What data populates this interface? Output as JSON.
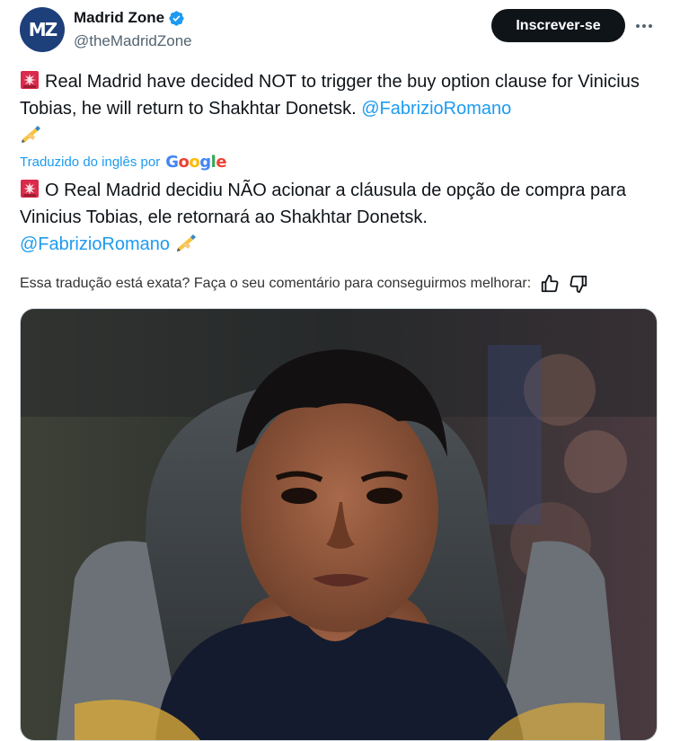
{
  "author": {
    "display_name": "Madrid Zone",
    "handle": "@theMadridZone",
    "avatar_text": "MZ",
    "verified_color": "#1d9bf0"
  },
  "actions": {
    "subscribe_label": "Inscrever-se",
    "more_icon": "more-horizontal-icon"
  },
  "tweet": {
    "original_text": "Real Madrid have decided NOT to trigger the buy option clause for Vinicius Tobias, he will return to Shakhtar Donetsk.",
    "original_mention": "@FabrizioRomano",
    "translation_label": "Traduzido do inglês por",
    "translation_brand": "Google",
    "translated_text": "O Real Madrid decidiu NÃO acionar a cláusula de opção de compra para Vinicius Tobias, ele retornará ao Shakhtar Donetsk.",
    "translated_mention": "@FabrizioRomano",
    "feedback_prompt": "Essa tradução está exata? Faça o seu comentário para conseguirmos melhorar:"
  },
  "colors": {
    "accent": "#1d9bf0",
    "text": "#0f1419",
    "muted": "#536471",
    "google_blue": "#4285f4",
    "google_red": "#ea4335",
    "google_yellow": "#fbbc05",
    "google_green": "#34a853"
  }
}
